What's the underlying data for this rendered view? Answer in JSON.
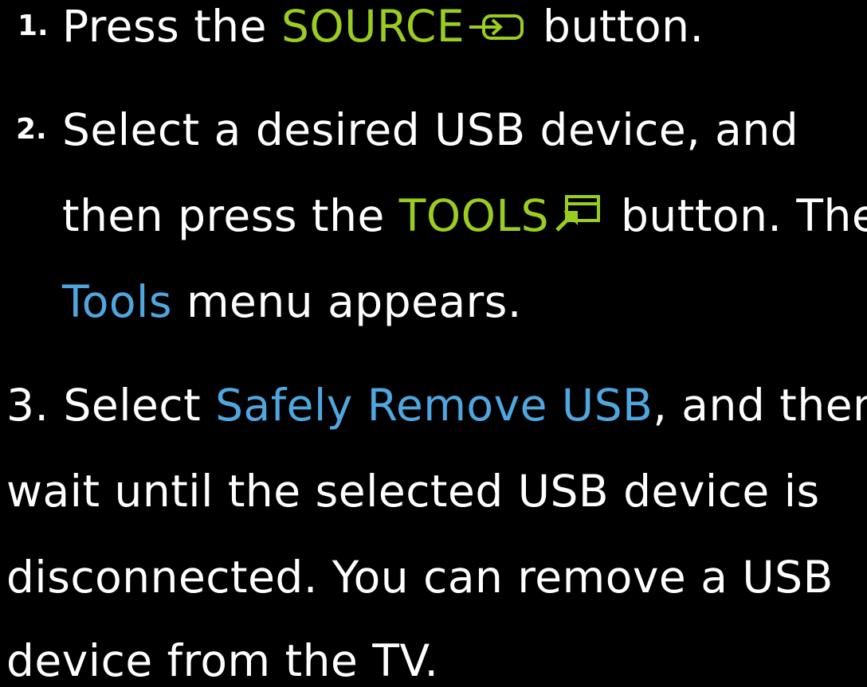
{
  "steps": [
    {
      "number": "1.",
      "lines": [
        {
          "before": "Press the ",
          "highlight": "SOURCE",
          "icon": "source-input-icon",
          "after": " button."
        }
      ]
    },
    {
      "number": "2.",
      "line1": "Select a desired USB device, and",
      "line2_before": "then press the ",
      "line2_highlight": "TOOLS",
      "line2_icon": "tools-icon",
      "line2_after": " button. The",
      "line3_highlight": "Tools",
      "line3_after": " menu appears."
    },
    {
      "number": "3.",
      "line1_before": " Select ",
      "line1_highlight": "Safely Remove USB",
      "line1_after": ", and then",
      "line2": "wait until the selected USB device is",
      "line3": "disconnected. You can remove a USB",
      "line4": "device from the TV."
    }
  ],
  "colors": {
    "background": "#000000",
    "text": "#FFFFFF",
    "button_highlight": "#9ACD1F",
    "menu_highlight": "#4FA7E0"
  }
}
